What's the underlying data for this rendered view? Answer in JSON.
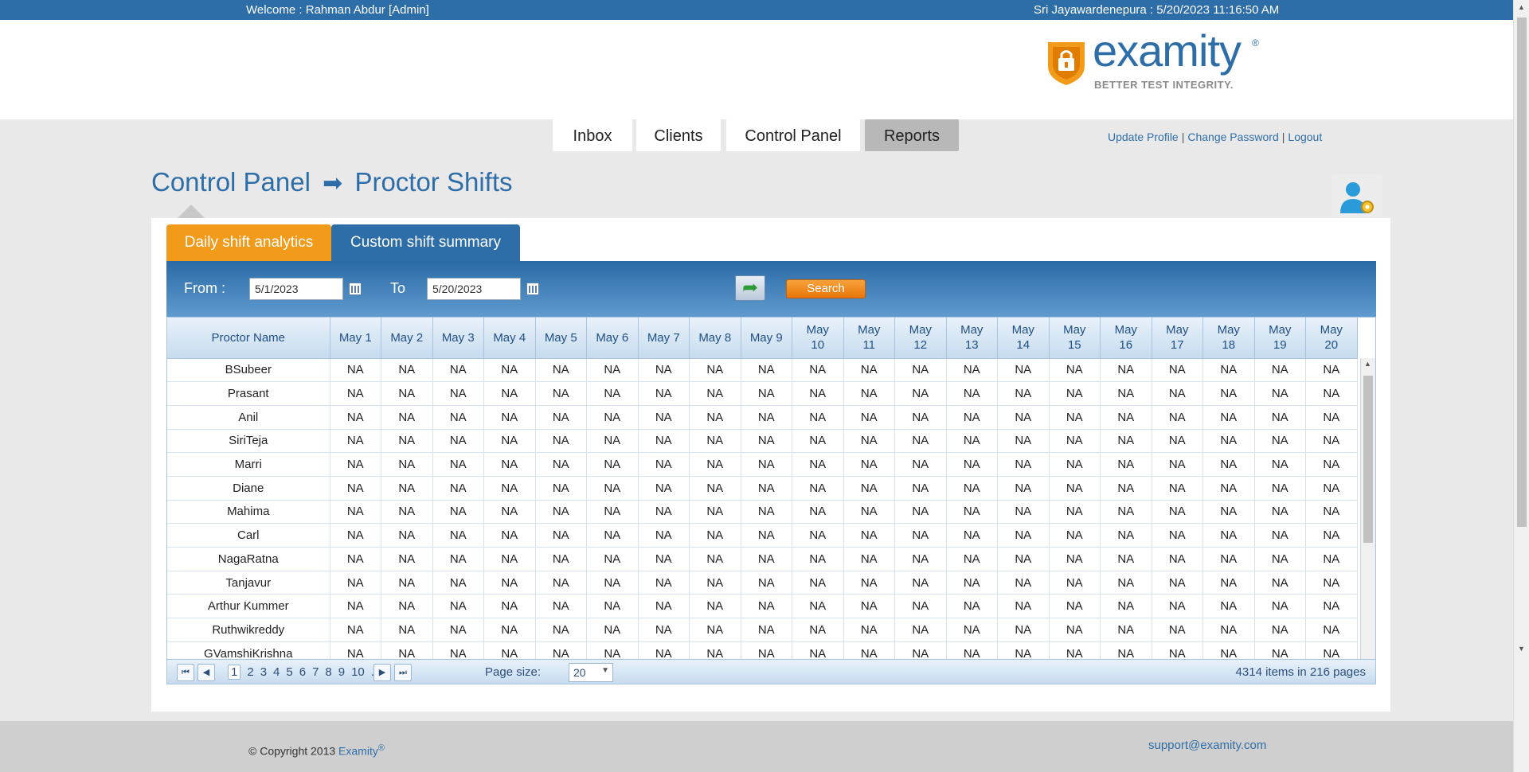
{
  "topbar": {
    "welcome": "Welcome : Rahman Abdur [Admin]",
    "clock": "Sri Jayawardenepura : 5/20/2023 11:16:50 AM"
  },
  "logo": {
    "word": "examity",
    "reg": "®",
    "tagline": "BETTER TEST INTEGRITY."
  },
  "nav": {
    "tabs": [
      {
        "label": "Inbox"
      },
      {
        "label": "Clients"
      },
      {
        "label": "Control Panel"
      },
      {
        "label": "Reports"
      }
    ],
    "links": {
      "update_profile": "Update Profile",
      "change_password": "Change Password",
      "logout": "Logout",
      "sep": "|"
    }
  },
  "page": {
    "title_part1": "Control Panel",
    "arrow": "➡",
    "title_part2": "Proctor Shifts"
  },
  "subtabs": {
    "daily": "Daily shift analytics",
    "custom": "Custom shift summary"
  },
  "filter": {
    "from_label": "From :",
    "from_value": "5/1/2023",
    "to_label": "To",
    "to_value": "5/20/2023",
    "search_label": "Search"
  },
  "table": {
    "columns": [
      "Proctor Name",
      "May 1",
      "May 2",
      "May 3",
      "May 4",
      "May 5",
      "May 6",
      "May 7",
      "May 8",
      "May 9",
      "May\n10",
      "May\n11",
      "May\n12",
      "May\n13",
      "May\n14",
      "May\n15",
      "May\n16",
      "May\n17",
      "May\n18",
      "May\n19",
      "May\n20"
    ],
    "rows": [
      {
        "name": "BSubeer"
      },
      {
        "name": "Prasant"
      },
      {
        "name": "Anil"
      },
      {
        "name": "SiriTeja"
      },
      {
        "name": "Marri"
      },
      {
        "name": "Diane"
      },
      {
        "name": "Mahima"
      },
      {
        "name": "Carl"
      },
      {
        "name": "NagaRatna"
      },
      {
        "name": "Tanjavur"
      },
      {
        "name": "Arthur Kummer"
      },
      {
        "name": "Ruthwikreddy"
      },
      {
        "name": "GVamshiKrishna"
      }
    ],
    "cell_value": "NA"
  },
  "pager": {
    "pages": [
      "1",
      "2",
      "3",
      "4",
      "5",
      "6",
      "7",
      "8",
      "9",
      "10",
      "..."
    ],
    "current_page": "1",
    "page_size_label": "Page size:",
    "page_size": "20",
    "info": "4314 items in 216 pages"
  },
  "footer": {
    "copyright": "© Copyright 2013",
    "brand": "Examity",
    "reg": "®",
    "email": "support@examity.com"
  }
}
